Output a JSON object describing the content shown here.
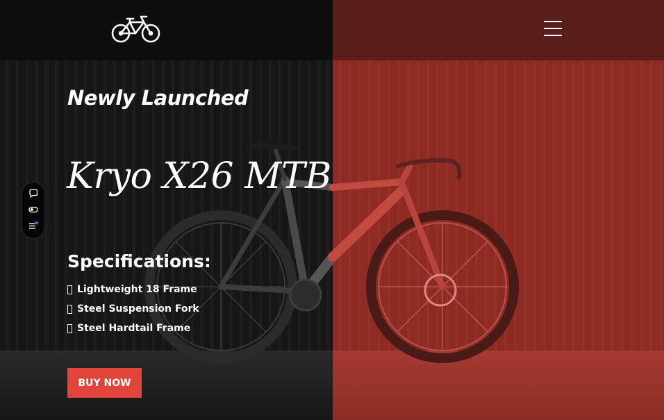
{
  "header": {
    "logo_icon": "bicycle-icon",
    "menu_icon": "hamburger-menu-icon"
  },
  "hero": {
    "eyebrow": "Newly Launched",
    "title": "Kryo X26 MTB",
    "specs_heading": "Specifications:",
    "specs": [
      "Lightweight 18 Frame",
      "Steel Suspension Fork",
      "Steel Hardtail Frame"
    ],
    "buy_label": "BUY NOW"
  },
  "side_toolbar": {
    "icons": [
      "chat-bubble-icon",
      "toggle-icon",
      "list-settings-icon"
    ]
  },
  "colors": {
    "left_panel": "#0c0d0d",
    "right_panel": "#5a1e1b",
    "accent": "#e0443a",
    "text": "#ffffff"
  }
}
